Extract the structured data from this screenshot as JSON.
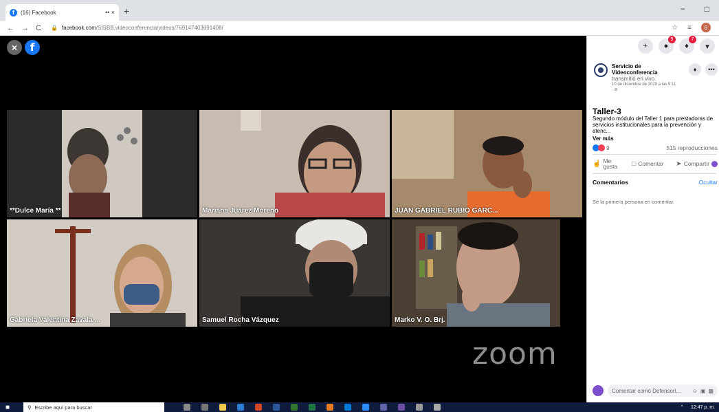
{
  "browser": {
    "tab_title": "(16) Facebook",
    "tab_icons": "•• ×",
    "new_tab": "+",
    "minimize": "−",
    "maximize": "̅□",
    "back": "←",
    "forward": "→",
    "reload": "C",
    "url_host": "facebook.com",
    "url_path": "/SISBB.videoconferencia/videos/769147403691408/",
    "star": "☆",
    "profile_initial": "6"
  },
  "video": {
    "close": "×",
    "fb_logo": "f",
    "watermark": "zoom",
    "participants": [
      "**Dulce María **",
      "Mariana Juárez Moreno",
      "JUAN GABRIEL RUBIO GARC...",
      "Gabriela Valentina Zavala ...",
      "Samuel Rocha Vázquez",
      "Marko V. O. Brj."
    ]
  },
  "panel": {
    "top_buttons": {
      "create": "+",
      "messenger_badge": "9",
      "notifications_badge": "7",
      "menu": "▾"
    },
    "page_name": "Servicio de Videoconferencia",
    "action": " transmitió en vivo.",
    "date": "10 de diciembre de 2020 a las 9:11",
    "privacy": "· ⊘",
    "bell": "♪",
    "more": "•••",
    "title": "Taller-3",
    "description": "Segundo módulo del Taller 1 para prestadoras de servicios institucionales para la prevención y atenc...",
    "see_more": "Ver más",
    "reaction_count": "9",
    "views": "515 reproducciones",
    "like": "Me gusta",
    "comment": "Comentar",
    "share": "Compartir",
    "comments_label": "Comentarios",
    "hide": "Ocultar",
    "first_comment": "Sé la primera persona en comentar.",
    "comment_placeholder": "Comentar como Defensori..."
  },
  "taskbar": {
    "search_placeholder": "Escribe aquí para buscar",
    "time": "12:47 p. m."
  },
  "colors": {
    "facebook_blue": "#1877f2",
    "badge_red": "#e41e3f",
    "taskbar": "#0f1c3d"
  }
}
